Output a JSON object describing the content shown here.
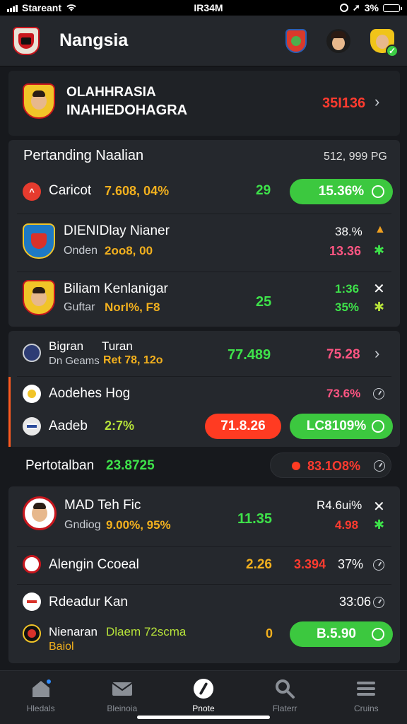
{
  "status_bar": {
    "carrier": "Stareant",
    "time": "IR34M",
    "battery": "3%"
  },
  "header": {
    "title": "Nangsia"
  },
  "featured": {
    "line1": "OLAHHRASIA",
    "line2": "INAHIEDOHAGRA",
    "value": "35I136"
  },
  "section1": {
    "title": "Pertanding Naalian",
    "meta": "512, 999  PG",
    "row1": {
      "name": "Caricot",
      "stat": "7.608, 04%",
      "num": "29",
      "pill": "15.36%"
    },
    "row2": {
      "name": "DIENIDlay Nianer",
      "sub_label": "Onden",
      "sub_value": "2oo8,  00",
      "pct": "38.%",
      "val": "13.36"
    },
    "row3": {
      "name": "Biliam Kenlanigar",
      "sub_label": "Guftar",
      "sub_value": "Norl%,   F8",
      "num": "25",
      "v1": "1:36",
      "v2": "35%"
    }
  },
  "section2": {
    "row1": {
      "name1": "Bigran",
      "name2": "Turan",
      "sub_label": "Dn Geams",
      "sub_value": "Ret 78, 12o",
      "num": "77.489",
      "val": "75.28"
    },
    "row2": {
      "name": "Aodehes Hog",
      "val": "73.6%"
    },
    "row3": {
      "name": "Aadeb",
      "stat": "2:7%",
      "red_pill": "71.8.26",
      "green_pill": "LC8109%"
    }
  },
  "total": {
    "label": "Pertotalban",
    "value": "23.8725",
    "pill": "83.1O8%"
  },
  "section3": {
    "row1": {
      "name": "MAD Teh Fic",
      "sub_label": "Gndiog",
      "sub_value": "9.00%,  95%",
      "num": "11.35",
      "v1": "R4.6ui%",
      "v2": "4.98"
    },
    "row2": {
      "name": "Alengin  Ccoeal",
      "num": "2.26",
      "red_val": "3.394",
      "pct": "37%"
    },
    "row3": {
      "name": "Rdeadur Kan",
      "val": "33:06"
    },
    "row4": {
      "name": "Nienaran",
      "sub": "Baiol",
      "stat": "Dlaem 72scma",
      "num": "0",
      "pill": "B.5.90"
    }
  },
  "bottom_nav": [
    "Hledals",
    "Bleinoia",
    "Pnote",
    "Flaterr",
    "Cruins"
  ],
  "colors": {
    "green": "#3ee24a",
    "red": "#ff3b2f",
    "yellow": "#f2b01e",
    "pink": "#ff5582",
    "pill_green": "#3cc83f",
    "pill_red": "#ff3b22"
  }
}
